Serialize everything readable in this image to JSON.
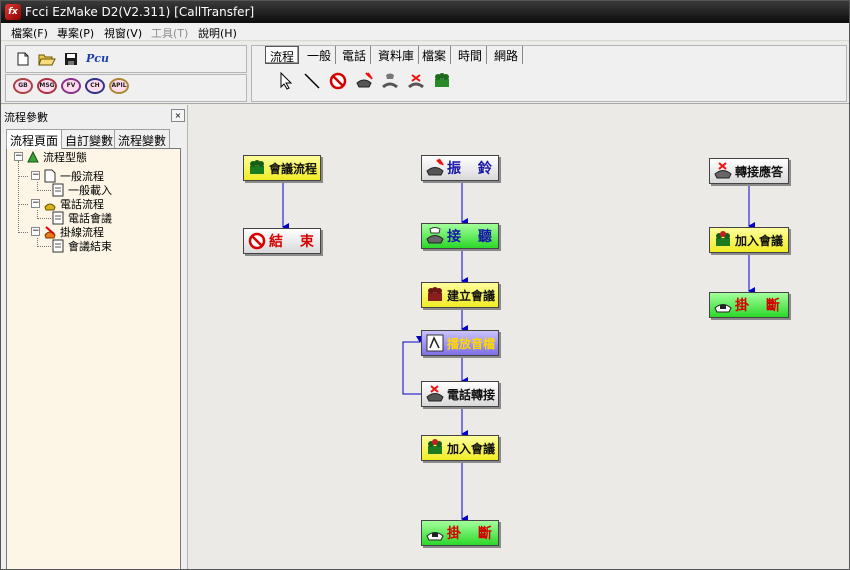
{
  "window": {
    "title": "Fcci EzMake D2(V2.311) [CallTransfer]",
    "app_icon_text": "fx"
  },
  "menu": [
    {
      "label": "檔案(F)",
      "enabled": true
    },
    {
      "label": "專案(P)",
      "enabled": true
    },
    {
      "label": "視窗(V)",
      "enabled": true
    },
    {
      "label": "工具(T)",
      "enabled": false
    },
    {
      "label": "說明(H)",
      "enabled": true
    }
  ],
  "toolbar": {
    "file_buttons": [
      "new-file-icon",
      "open-folder-icon",
      "save-icon"
    ],
    "pcu_label": "Pcu",
    "round_buttons": [
      "GB",
      "MSG",
      "FV",
      "CH",
      "APIL"
    ]
  },
  "palette_tabs": [
    "流程",
    "一般",
    "電話",
    "資料庫",
    "檔案",
    "時間",
    "網路"
  ],
  "palette_icons": [
    "pointer-arrow-icon",
    "line-tool-icon",
    "stop-icon",
    "phone-ring-icon",
    "phone-answer-icon",
    "phone-transfer-icon",
    "conference-icon"
  ],
  "left_panel": {
    "title": "流程參數",
    "close_label": "×",
    "tabs": [
      "流程頁面",
      "自訂變數",
      "流程變數"
    ],
    "tree": {
      "root": "流程型態",
      "groups": [
        {
          "label": "一般流程",
          "children": [
            "一般載入"
          ]
        },
        {
          "label": "電話流程",
          "children": [
            "電話會議"
          ]
        },
        {
          "label": "掛線流程",
          "children": [
            "會議結束"
          ]
        }
      ]
    }
  },
  "flow": {
    "nodes": [
      {
        "id": "conf",
        "label": "會議流程"
      },
      {
        "id": "end",
        "label": "結 束"
      },
      {
        "id": "ring",
        "label": "振 鈴"
      },
      {
        "id": "answer",
        "label": "接 聽"
      },
      {
        "id": "setup",
        "label": "建立會議"
      },
      {
        "id": "play",
        "label": "播放音檔"
      },
      {
        "id": "transfer",
        "label": "電話轉接"
      },
      {
        "id": "join1",
        "label": "加入會議"
      },
      {
        "id": "hang1",
        "label": "掛 斷"
      },
      {
        "id": "tanswer",
        "label": "轉接應答"
      },
      {
        "id": "join2",
        "label": "加入會議"
      },
      {
        "id": "hang2",
        "label": "掛 斷"
      }
    ]
  },
  "colors": {
    "node_yellow": "#f0ec26",
    "node_green": "#2bd82a",
    "node_purple": "#7e6fe4",
    "connector": "#0000cc",
    "title_red": "#d50000"
  }
}
